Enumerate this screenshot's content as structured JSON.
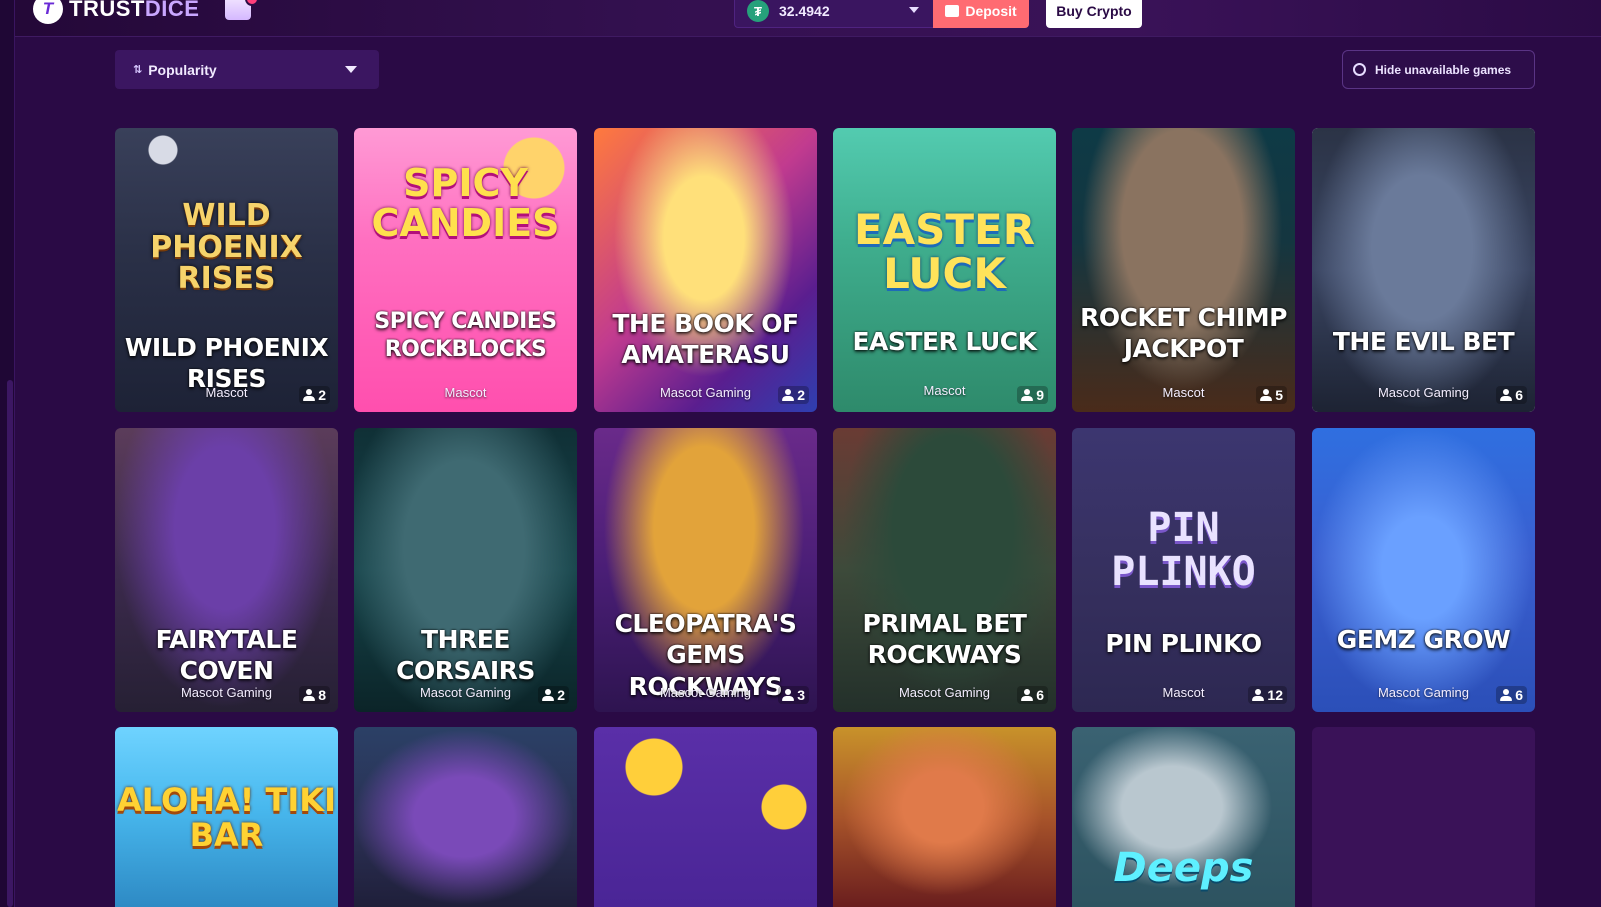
{
  "header": {
    "brand": "TRUSTDICE",
    "brand_main": "TRUST",
    "brand_accent": "DICE",
    "wallet": {
      "balance": "32.4942",
      "coin_icon": "tether-icon"
    },
    "deposit_label": "Deposit",
    "buy_crypto_label": "Buy Crypto"
  },
  "filters": {
    "sort_label": "Popularity",
    "hide_unavailable_label": "Hide unavailable games"
  },
  "games": [
    {
      "title": "WILD PHOENIX RISES",
      "logo": "Wild Phoenix Rises",
      "provider": "Mascot",
      "players": "2"
    },
    {
      "title": "SPICY CANDIES ROCKBLOCKS",
      "logo": "Spicy Candies",
      "provider": "Mascot",
      "players": ""
    },
    {
      "title": "THE BOOK OF AMATERASU",
      "logo": "",
      "provider": "Mascot Gaming",
      "players": "2"
    },
    {
      "title": "EASTER LUCK",
      "logo": "Easter Luck",
      "provider": "Mascot",
      "players": "9"
    },
    {
      "title": "ROCKET CHIMP JACKPOT",
      "logo": "",
      "provider": "Mascot",
      "players": "5"
    },
    {
      "title": "THE EVIL BET",
      "logo": "",
      "provider": "Mascot Gaming",
      "players": "6"
    },
    {
      "title": "FAIRYTALE COVEN",
      "logo": "",
      "provider": "Mascot Gaming",
      "players": "8"
    },
    {
      "title": "THREE CORSAIRS",
      "logo": "",
      "provider": "Mascot Gaming",
      "players": "2"
    },
    {
      "title": "CLEOPATRA'S GEMS ROCKWAYS",
      "logo": "",
      "provider": "Mascot Gaming",
      "players": "3"
    },
    {
      "title": "PRIMAL BET ROCKWAYS",
      "logo": "",
      "provider": "Mascot Gaming",
      "players": "6"
    },
    {
      "title": "PIN PLINKO",
      "logo": "PIN PLINKO",
      "provider": "Mascot",
      "players": "12"
    },
    {
      "title": "GEMZ GROW",
      "logo": "",
      "provider": "Mascot Gaming",
      "players": "6"
    },
    {
      "title": "",
      "logo": "ALOHA! TIKI BAR",
      "provider": "",
      "players": ""
    },
    {
      "title": "",
      "logo": "",
      "provider": "",
      "players": ""
    },
    {
      "title": "",
      "logo": "",
      "provider": "",
      "players": ""
    },
    {
      "title": "",
      "logo": "",
      "provider": "",
      "players": ""
    },
    {
      "title": "",
      "logo": "Deeps",
      "provider": "",
      "players": ""
    }
  ],
  "theme": {
    "background": "#2a0a45",
    "deposit": "#ff6b72",
    "accent": "#c9a7ff"
  }
}
